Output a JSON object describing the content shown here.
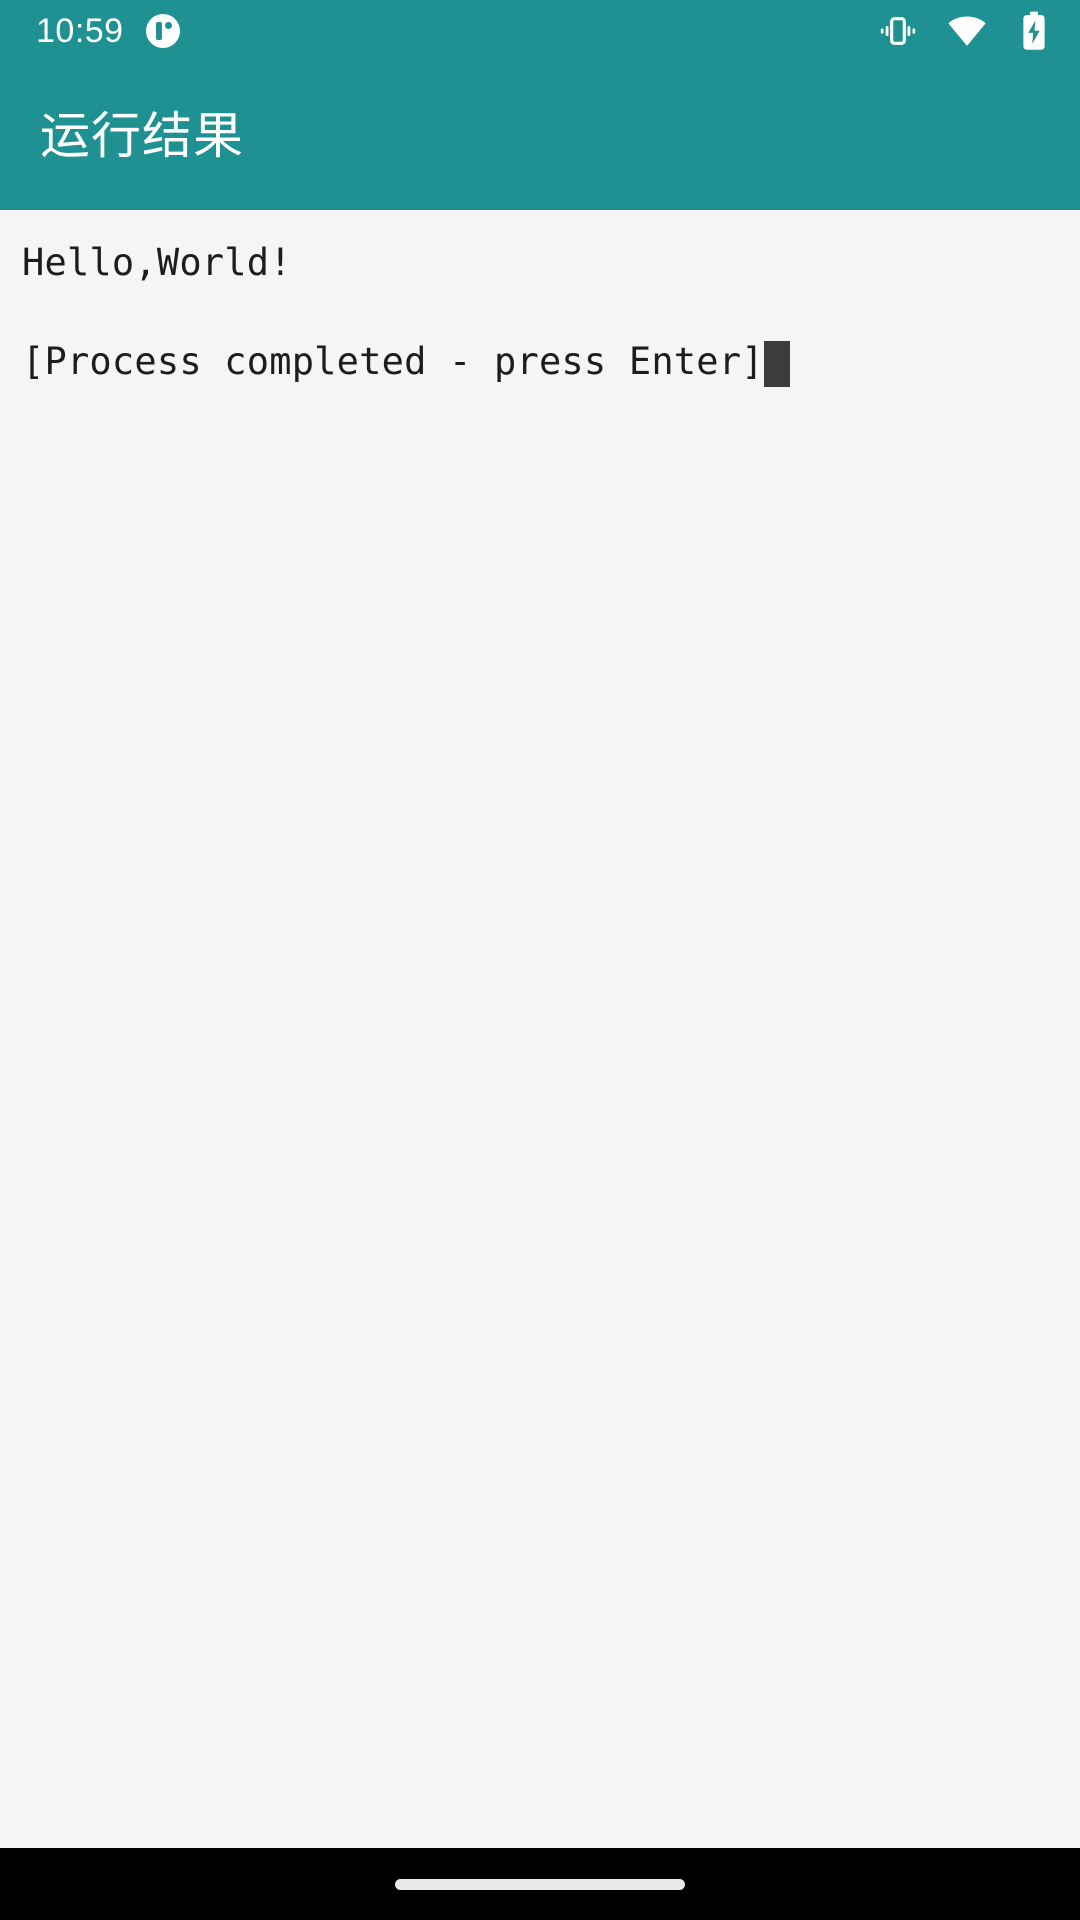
{
  "status_bar": {
    "clock": "10:59",
    "app_badge_icon": "app-circle-icon",
    "icons": [
      {
        "name": "vibrate-icon",
        "label": "Vibrate mode"
      },
      {
        "name": "wifi-icon",
        "label": "Wi-Fi full signal"
      },
      {
        "name": "battery-charging-icon",
        "label": "Battery charging"
      }
    ]
  },
  "app_bar": {
    "title": "运行结果"
  },
  "terminal": {
    "lines": [
      "Hello,World!",
      "[Process completed - press Enter]"
    ],
    "cursor_visible": true
  },
  "nav_bar": {
    "gesture_pill": "home-gesture-pill"
  },
  "colors": {
    "accent_teal": "#1F9193",
    "content_background": "#F5F5F5",
    "text_primary": "#1D1D1D",
    "cursor": "#3C3C3C",
    "nav_background": "#000000",
    "status_icon": "#FFFFFF"
  }
}
